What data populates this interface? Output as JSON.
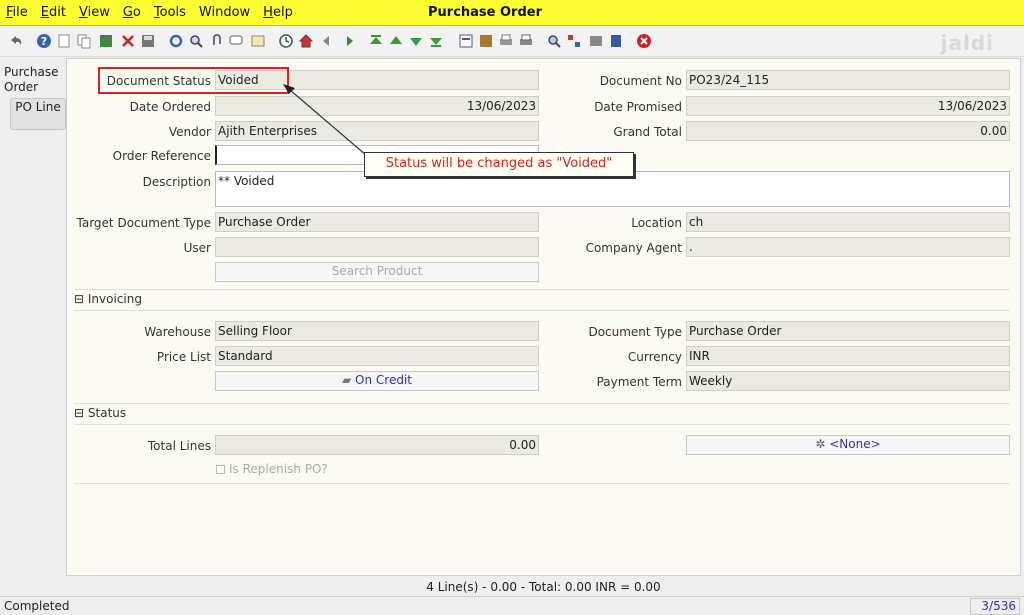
{
  "menu": {
    "file": "F",
    "file_rest": "ile",
    "edit": "E",
    "edit_rest": "dit",
    "view": "V",
    "view_rest": "iew",
    "go": "G",
    "go_rest": "o",
    "tools": "T",
    "tools_rest": "ools",
    "window": "Window",
    "help": "H",
    "help_rest": "elp"
  },
  "window_title": "Purchase Order",
  "logo": "jaldi",
  "side_tabs": {
    "tab1": "Purchase Order",
    "tab2": "PO Line"
  },
  "fields": {
    "document_status": {
      "label": "Document Status",
      "value": "Voided"
    },
    "document_no": {
      "label": "Document No",
      "value": "PO23/24_115"
    },
    "date_ordered": {
      "label": "Date Ordered",
      "value": "13/06/2023"
    },
    "date_promised": {
      "label": "Date Promised",
      "value": "13/06/2023"
    },
    "vendor": {
      "label": "Vendor",
      "value": "Ajith Enterprises"
    },
    "grand_total": {
      "label": "Grand Total",
      "value": "0.00"
    },
    "order_reference": {
      "label": "Order Reference",
      "value": ""
    },
    "description": {
      "label": "Description",
      "value": "** Voided"
    },
    "target_document_type": {
      "label": "Target Document Type",
      "value": "Purchase Order"
    },
    "location": {
      "label": "Location",
      "value": "ch"
    },
    "user": {
      "label": "User",
      "value": ""
    },
    "company_agent": {
      "label": "Company Agent",
      "value": "."
    },
    "search_product": "Search Product",
    "warehouse": {
      "label": "Warehouse",
      "value": "Selling Floor"
    },
    "document_type": {
      "label": "Document Type",
      "value": "Purchase Order"
    },
    "price_list": {
      "label": "Price List",
      "value": "Standard"
    },
    "currency": {
      "label": "Currency",
      "value": "INR"
    },
    "payment_rule": "On Credit",
    "payment_term": {
      "label": "Payment Term",
      "value": "Weekly"
    },
    "total_lines": {
      "label": "Total Lines",
      "value": "0.00"
    },
    "none_button": "<None>",
    "is_replenish": "Is Replenish PO?"
  },
  "sections": {
    "invoicing": "Invoicing",
    "status": "Status"
  },
  "annotation": "Status will be changed as \"Voided\"",
  "summary": "4 Line(s) - 0.00 -  Total: 0.00  INR  =  0.00",
  "statusbar": {
    "left": "Completed",
    "right": "3/536"
  },
  "colors": {
    "titlebar": "#ffff33",
    "annotation_red": "#e02020",
    "link_blue": "#3030b0"
  }
}
